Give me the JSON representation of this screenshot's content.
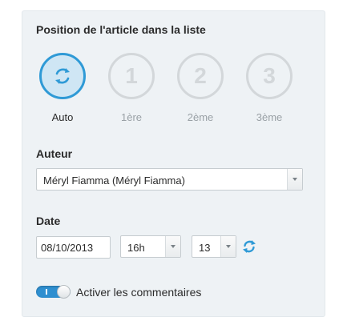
{
  "position_section": {
    "title": "Position de l'article dans la liste",
    "options": [
      {
        "label": "Auto",
        "icon": "refresh-icon",
        "active": true
      },
      {
        "label": "1ère",
        "number": "1",
        "active": false
      },
      {
        "label": "2ème",
        "number": "2",
        "active": false
      },
      {
        "label": "3ème",
        "number": "3",
        "active": false
      }
    ]
  },
  "author_section": {
    "title": "Auteur",
    "selected": "Méryl Fiamma (Méryl Fiamma)"
  },
  "date_section": {
    "title": "Date",
    "date_value": "08/10/2013",
    "hour": "16h",
    "minute": "13"
  },
  "comments_toggle": {
    "label": "Activer les commentaires",
    "enabled": true
  },
  "colors": {
    "accent": "#2f9ad6",
    "panel_bg": "#eef2f5",
    "inactive": "#d3d7da"
  }
}
